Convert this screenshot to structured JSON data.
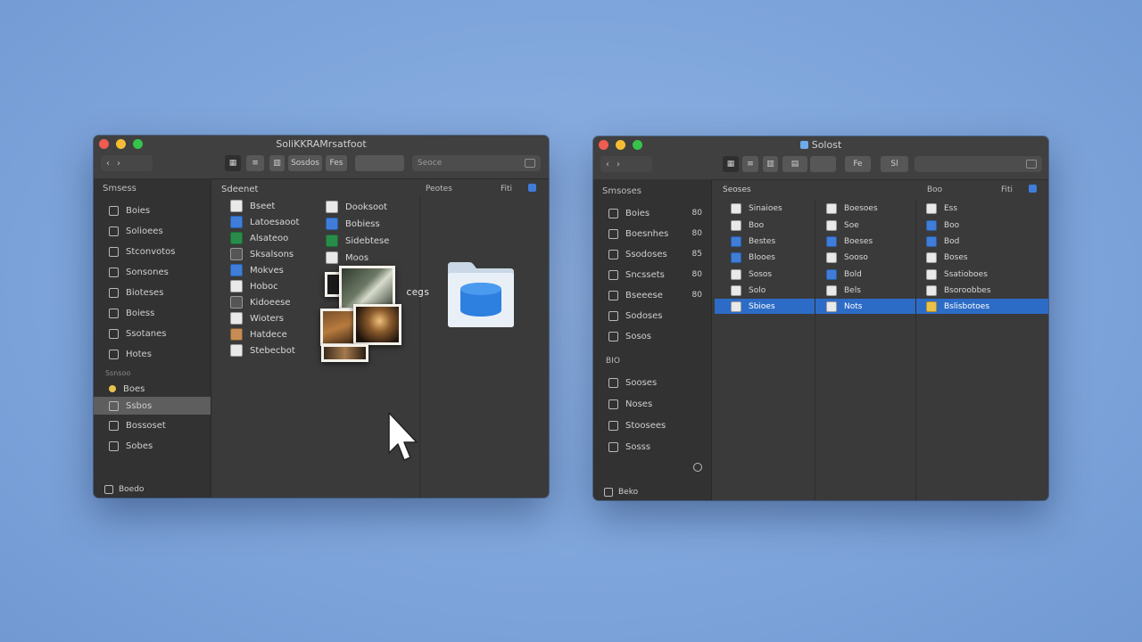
{
  "left_window": {
    "title": "SoliKKRAMrsatfoot",
    "toolbar": {
      "a": "Sosdos",
      "b": "Fes",
      "search": "Seoce"
    },
    "sidebar": {
      "heading": "Smsess",
      "items": [
        {
          "label": "Boies"
        },
        {
          "label": "Solioees"
        },
        {
          "label": "Stconvotos"
        },
        {
          "label": "Sonsones"
        },
        {
          "label": "Bioteses"
        },
        {
          "label": "Boiess"
        },
        {
          "label": "Ssotanes"
        },
        {
          "label": "Hotes"
        }
      ],
      "section_label": "Ssnsoo",
      "items2": [
        {
          "label": "Boes"
        },
        {
          "label": "Ssbos"
        },
        {
          "label": "Bossoset"
        },
        {
          "label": "Sobes"
        }
      ],
      "bottom": "Boedo"
    },
    "content": {
      "header": "Sdeenet",
      "sort_label": "Peotes",
      "view_label": "Fiti",
      "files_col1": [
        {
          "label": "Bseet"
        },
        {
          "label": "Latoesaoot"
        },
        {
          "label": "Alsateoo"
        },
        {
          "label": "Sksalsons"
        },
        {
          "label": "Mokves"
        },
        {
          "label": "Hoboc"
        },
        {
          "label": "Kidoeese"
        },
        {
          "label": "Wioters"
        },
        {
          "label": "Hatdece"
        },
        {
          "label": "Stebecbot"
        }
      ],
      "files_col2": [
        {
          "label": "Dooksoot"
        },
        {
          "label": "Bobiess"
        },
        {
          "label": "Sidebtese"
        },
        {
          "label": "Moos"
        }
      ],
      "drag_label": "cegs"
    }
  },
  "right_window": {
    "title": "Solost",
    "toolbar": {
      "a": "Fe",
      "b": "Sl"
    },
    "sidebar": {
      "heading": "Smsoses",
      "items": [
        {
          "label": "Boies",
          "count": "80"
        },
        {
          "label": "Boesnhes",
          "count": "80"
        },
        {
          "label": "Ssodoses",
          "count": "85"
        },
        {
          "label": "Sncssets",
          "count": "80"
        },
        {
          "label": "Bseeese",
          "count": "80"
        },
        {
          "label": "Sodoses",
          "count": ""
        },
        {
          "label": "Sosos",
          "count": ""
        }
      ],
      "section_label": "BIO",
      "items2": [
        {
          "label": "Sooses"
        },
        {
          "label": "Noses"
        },
        {
          "label": "Stoosees"
        },
        {
          "label": "Sosss"
        }
      ],
      "bottom": "Beko"
    },
    "content": {
      "header": "Seoses",
      "col3_header": "Boo",
      "sort_label": "Fiti",
      "col1": [
        {
          "label": "Sinaioes"
        },
        {
          "label": "Boo"
        },
        {
          "label": "Bestes"
        },
        {
          "label": "Blooes"
        },
        {
          "label": "Sosos"
        },
        {
          "label": "Solo"
        },
        {
          "label": "Sbioes"
        }
      ],
      "col2": [
        {
          "label": "Boesoes"
        },
        {
          "label": "Soe"
        },
        {
          "label": "Boeses"
        },
        {
          "label": "Sooso"
        },
        {
          "label": "Bold"
        },
        {
          "label": "Bels"
        },
        {
          "label": "Nots"
        }
      ],
      "col3": [
        {
          "label": "Ess"
        },
        {
          "label": "Boo"
        },
        {
          "label": "Bod"
        },
        {
          "label": "Boses"
        },
        {
          "label": "Ssatioboes"
        },
        {
          "label": "Bsoroobbes"
        },
        {
          "label": "Bslisbotoes"
        }
      ]
    }
  },
  "colors": {
    "desktop": "#7fa6dc",
    "window": "#3a3a3a",
    "sidebar": "#323232",
    "selection": "#2d6cc6"
  }
}
